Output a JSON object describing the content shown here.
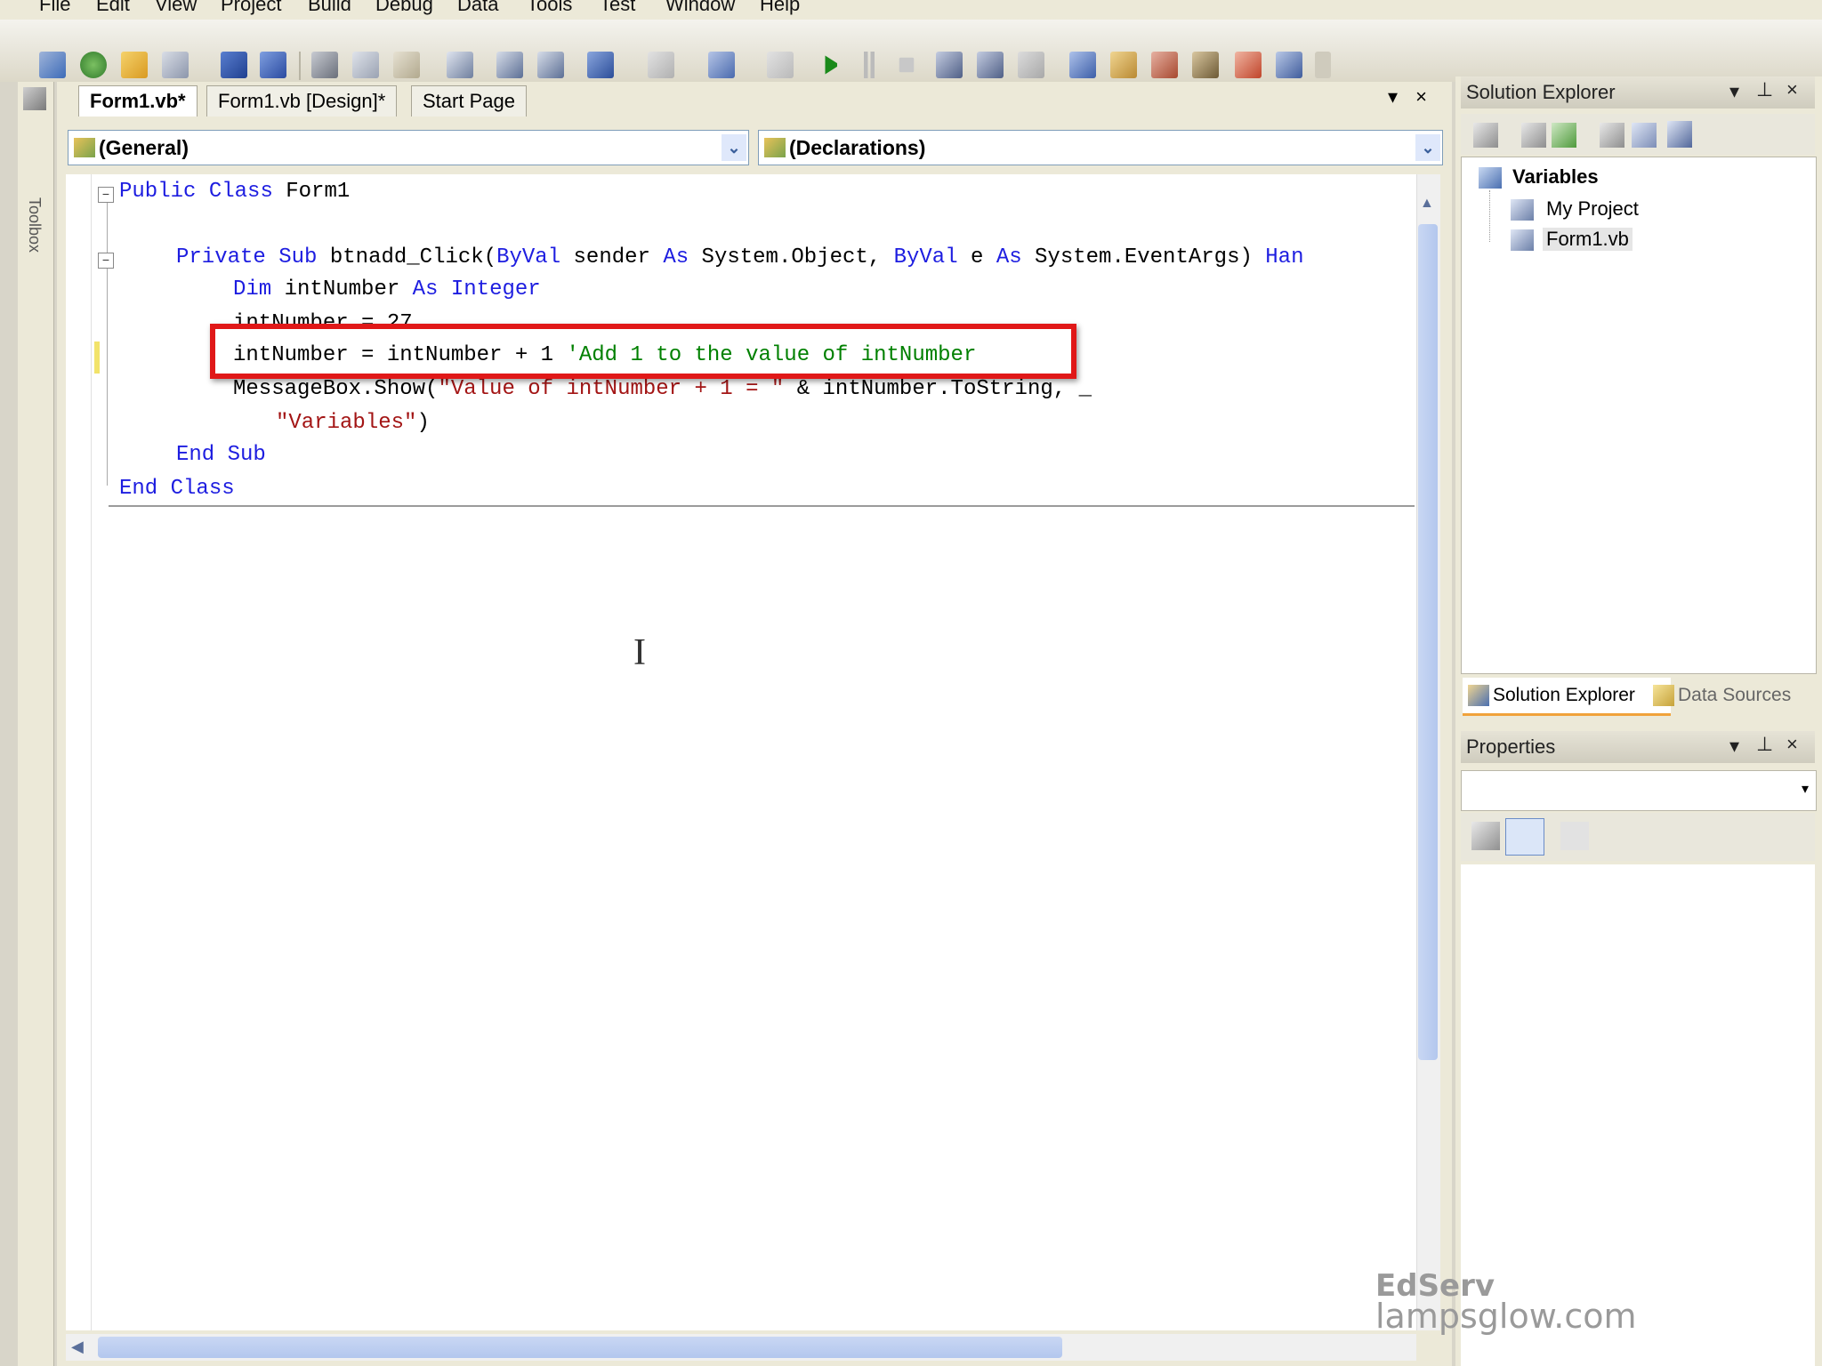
{
  "menu": [
    "File",
    "Edit",
    "View",
    "Project",
    "Build",
    "Debug",
    "Data",
    "Tools",
    "Test",
    "Window",
    "Help"
  ],
  "toolbox_label": "Toolbox",
  "tabs": [
    {
      "label": "Form1.vb*"
    },
    {
      "label": "Form1.vb [Design]*"
    },
    {
      "label": "Start Page"
    }
  ],
  "tab_controls": {
    "dropdown": "▾",
    "close": "×"
  },
  "combos": {
    "left": "(General)",
    "right": "(Declarations)"
  },
  "code": {
    "l1_kw1": "Public",
    "l1_kw2": "Class",
    "l1_name": "Form1",
    "l2_kw1": "Private",
    "l2_kw2": "Sub",
    "l2_name": "btnadd_Click(",
    "l2_byval1": "ByVal",
    "l2_sender": " sender ",
    "l2_as1": "As",
    "l2_type1": " System.Object, ",
    "l2_byval2": "ByVal",
    "l2_e": " e ",
    "l2_as2": "As",
    "l2_type2": " System.EventArgs) ",
    "l2_han": "Han",
    "l3_dim": "Dim",
    "l3_var": " intNumber ",
    "l3_as": "As",
    "l3_type": " Integer",
    "l4": "intNumber = 27",
    "l5_code": "intNumber = intNumber + 1 ",
    "l5_comment": "'Add 1 to the value of intNumber",
    "l6_a": "MessageBox.Show(",
    "l6_str": "\"Value of intNumber + 1 = \"",
    "l6_b": " & intNumber.ToString, _",
    "l7_str": "\"Variables\"",
    "l7_close": ")",
    "l8_end": "End",
    "l8_sub": "Sub",
    "l9_end": "End",
    "l9_class": "Class"
  },
  "solution_explorer": {
    "title": "Solution Explorer",
    "root": "Variables",
    "items": [
      "My Project",
      "Form1.vb"
    ]
  },
  "bottom_tabs": [
    "Solution Explorer",
    "Data Sources"
  ],
  "properties": {
    "title": "Properties"
  },
  "watermark": {
    "line1": "EdServ",
    "line2": "lampsglow.com"
  }
}
